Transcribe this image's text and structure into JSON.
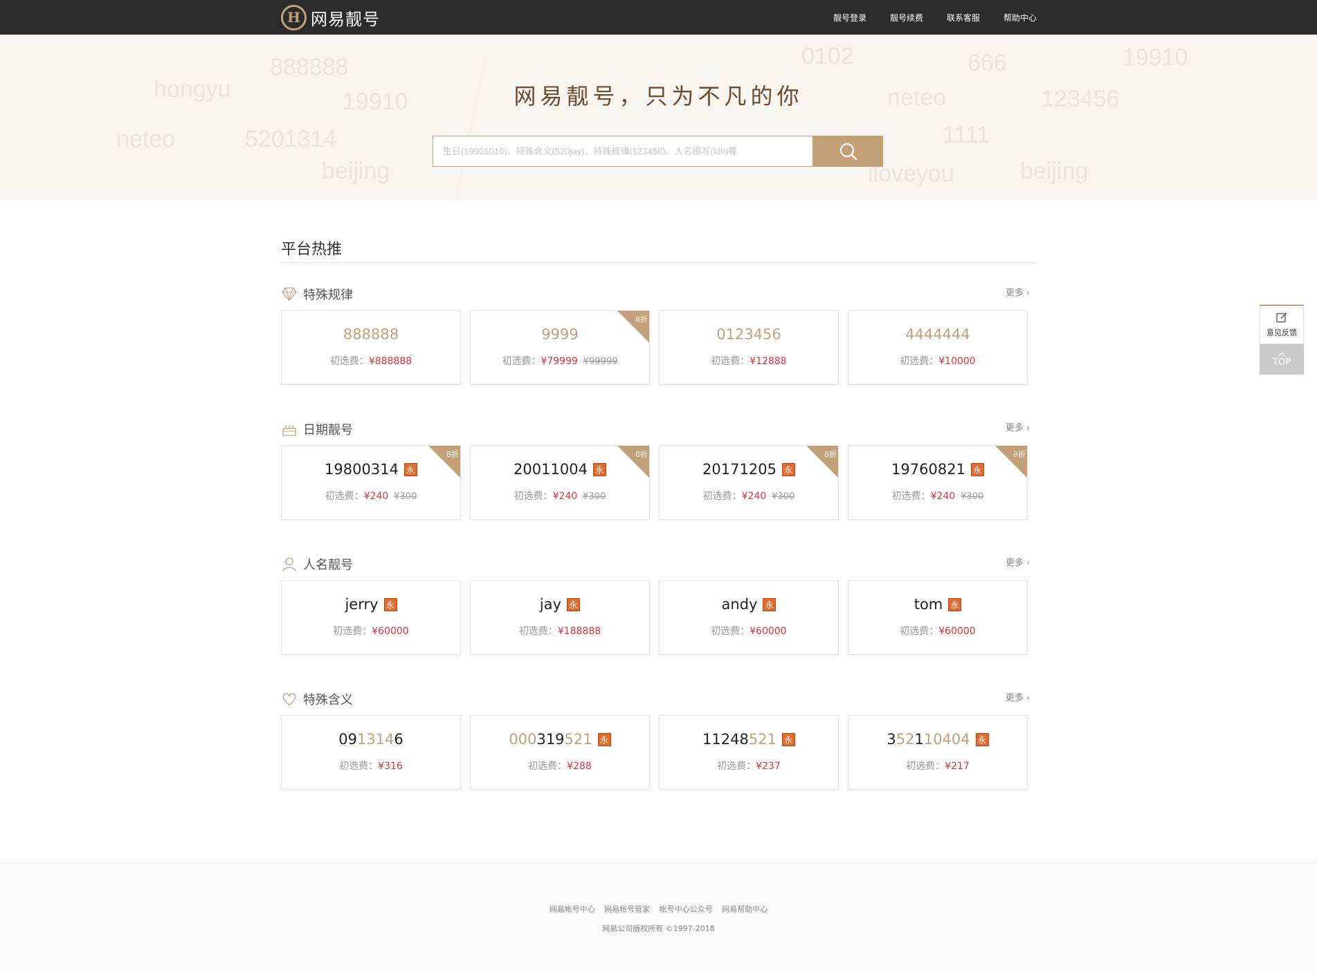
{
  "brand": {
    "logo_mark": "H",
    "name": "网易靓号"
  },
  "topnav": [
    "靓号登录",
    "靓号续费",
    "联系客服",
    "帮助中心"
  ],
  "banner": {
    "slogan": "网易靓号，只为不凡的你",
    "search_placeholder": "生日(19901010)、特殊含义(520jay)、特殊规律(123456)、人名缩写(ldh)等",
    "bg_words": [
      "888888",
      "hongyu",
      "19910",
      "neteo",
      "5201314",
      "beijing",
      "0102",
      "666",
      "19910",
      "neteo",
      "123456",
      "1111",
      "iloveyou",
      "beijing"
    ]
  },
  "section_title": "平台热推",
  "more_label": "更多",
  "categories": [
    {
      "name": "特殊规律",
      "icon": "diamond-icon",
      "cards": [
        {
          "number": "888888",
          "gold": true,
          "fee_label": "初选费：",
          "fee": "¥888888"
        },
        {
          "number": "9999",
          "gold": true,
          "fee_label": "初选费：",
          "fee": "¥79999",
          "original": "¥99999",
          "discount": "8折"
        },
        {
          "number": "0123456",
          "gold": true,
          "fee_label": "初选费：",
          "fee": "¥12888"
        },
        {
          "number": "4444444",
          "gold": true,
          "fee_label": "初选费：",
          "fee": "¥10000"
        }
      ]
    },
    {
      "name": "日期靓号",
      "icon": "cake-icon",
      "cards": [
        {
          "number": "19800314",
          "yong": "永",
          "fee_label": "初选费：",
          "fee": "¥240",
          "original": "¥300",
          "discount": "8折"
        },
        {
          "number": "20011004",
          "yong": "永",
          "fee_label": "初选费：",
          "fee": "¥240",
          "original": "¥300",
          "discount": "8折"
        },
        {
          "number": "20171205",
          "yong": "永",
          "fee_label": "初选费：",
          "fee": "¥240",
          "original": "¥300",
          "discount": "8折"
        },
        {
          "number": "19760821",
          "yong": "永",
          "fee_label": "初选费：",
          "fee": "¥240",
          "original": "¥300",
          "discount": "8折"
        }
      ]
    },
    {
      "name": "人名靓号",
      "icon": "person-icon",
      "cards": [
        {
          "number": "jerry",
          "yong": "永",
          "fee_label": "初选费：",
          "fee": "¥60000"
        },
        {
          "number": "jay",
          "yong": "永",
          "fee_label": "初选费：",
          "fee": "¥188888"
        },
        {
          "number": "andy",
          "yong": "永",
          "fee_label": "初选费：",
          "fee": "¥60000"
        },
        {
          "number": "tom",
          "yong": "永",
          "fee_label": "初选费：",
          "fee": "¥60000"
        }
      ]
    },
    {
      "name": "特殊含义",
      "icon": "heart-icon",
      "cards": [
        {
          "parts": [
            {
              "t": "09",
              "h": false
            },
            {
              "t": "1314",
              "h": true
            },
            {
              "t": "6",
              "h": false
            }
          ],
          "fee_label": "初选费：",
          "fee": "¥316"
        },
        {
          "parts": [
            {
              "t": "000",
              "h": true
            },
            {
              "t": "319",
              "h": false
            },
            {
              "t": "521",
              "h": true
            }
          ],
          "yong": "永",
          "fee_label": "初选费：",
          "fee": "¥288"
        },
        {
          "parts": [
            {
              "t": "11248",
              "h": false
            },
            {
              "t": "521",
              "h": true
            }
          ],
          "yong": "永",
          "fee_label": "初选费：",
          "fee": "¥237"
        },
        {
          "parts": [
            {
              "t": "3",
              "h": false
            },
            {
              "t": "52",
              "h": true
            },
            {
              "t": "1",
              "h": false
            },
            {
              "t": "10404",
              "h": true
            }
          ],
          "yong": "永",
          "fee_label": "初选费：",
          "fee": "¥217"
        }
      ]
    }
  ],
  "side": {
    "feedback_label": "意见反馈",
    "top_label": "TOP"
  },
  "footer": {
    "links": [
      "网易帐号中心",
      "网易帐号管家",
      "帐号中心公众号",
      "网易帮助中心"
    ],
    "copyright": "网易公司版权所有 ©1997-2018"
  },
  "colors": {
    "accent": "#c4a079",
    "dark_bar": "#2b2b2b",
    "price_red": "#e0323a",
    "badge_orange": "#e56a2a"
  }
}
